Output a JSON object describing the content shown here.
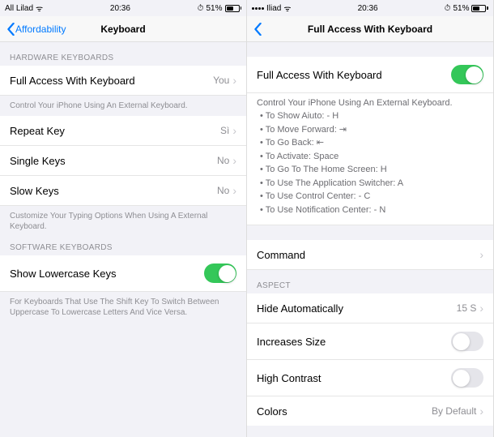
{
  "left": {
    "status": {
      "carrier": "All Lilad",
      "time": "20:36",
      "battery": "51%"
    },
    "nav": {
      "back": "Affordability",
      "title": "Keyboard"
    },
    "sections": {
      "hardware": {
        "header": "HARDWARE KEYBOARDS",
        "rows": {
          "full_access": {
            "label": "Full Access With Keyboard",
            "value": "You"
          },
          "repeat": {
            "label": "Repeat Key",
            "value": "Sì"
          },
          "single": {
            "label": "Single Keys",
            "value": "No"
          },
          "slow": {
            "label": "Slow Keys",
            "value": "No"
          }
        },
        "footer1": "Control Your iPhone Using An External Keyboard.",
        "footer2": "Customize Your Typing Options When Using A External Keyboard."
      },
      "software": {
        "header": "SOFTWARE KEYBOARDS",
        "rows": {
          "lowercase": {
            "label": "Show Lowercase Keys"
          }
        },
        "footer": "For Keyboards That Use The Shift Key To Switch Between Uppercase To Lowercase Letters And Vice Versa."
      }
    }
  },
  "right": {
    "status": {
      "carrier": "Iliad",
      "time": "20:36",
      "battery": "51%"
    },
    "nav": {
      "title": "Full Access With Keyboard"
    },
    "toggle_row": {
      "label": "Full Access With Keyboard"
    },
    "help": {
      "intro": "Control Your iPhone Using An External Keyboard.",
      "items": [
        "To Show Aiuto: - H",
        "To Move Forward: ⇥",
        "To Go Back: ⇤",
        "To Activate: Space",
        "To Go To The Home Screen: H",
        "To Use The Application Switcher: A",
        "To Use Control Center: - C",
        "To Use Notification Center: - N"
      ]
    },
    "command": {
      "label": "Command"
    },
    "aspect": {
      "header": "ASPECT",
      "rows": {
        "hide": {
          "label": "Hide Automatically",
          "value": "15 S"
        },
        "size": {
          "label": "Increases Size"
        },
        "contrast": {
          "label": "High Contrast"
        },
        "colors": {
          "label": "Colors",
          "value": "By Default"
        }
      }
    }
  }
}
